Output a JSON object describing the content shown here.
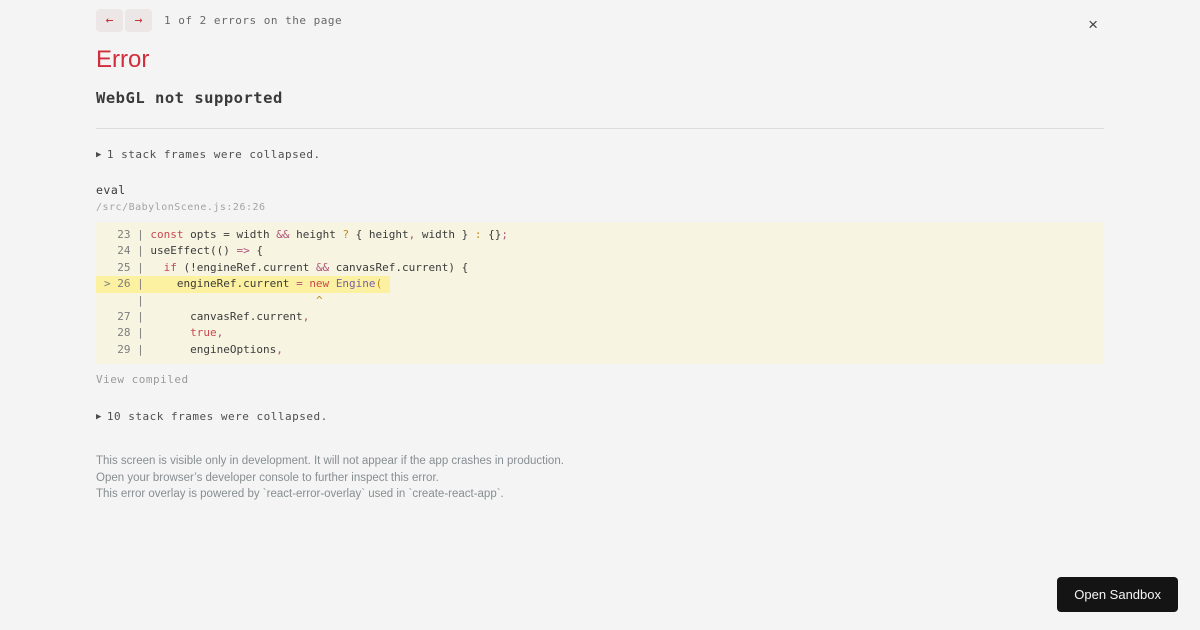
{
  "colors": {
    "page_bg": "#f4f4f4",
    "nav_btn_bg": "#ece6e6",
    "nav_arrow": "#c43333",
    "title_red": "#cf2f3c",
    "code_bg": "#f7f4e2",
    "code_hl_bg": "#fcf0a1",
    "kw": "#c9484f",
    "op": "#ad5176",
    "type": "#7a5cad",
    "punct": "#bf8a1d",
    "sandbox_bg": "#141414"
  },
  "topbar": {
    "prev_label": "←",
    "next_label": "→",
    "counter": "1 of 2 errors on the page",
    "close_label": "×"
  },
  "error": {
    "title": "Error",
    "message": "WebGL not supported"
  },
  "stack": {
    "collapsed_top_icon": "▶",
    "collapsed_top": "1 stack frames were collapsed.",
    "frame_function": "eval",
    "frame_location": "/src/BabylonScene.js:26:26",
    "view_toggle": "View compiled",
    "collapsed_bottom_icon": "▶",
    "collapsed_bottom": "10 stack frames were collapsed."
  },
  "code_frame": {
    "lines": [
      {
        "highlight": false,
        "tokens": [
          [
            "  23 | ",
            "num"
          ],
          [
            "const",
            "kw"
          ],
          [
            " opts = width ",
            "txt"
          ],
          [
            "&&",
            "op"
          ],
          [
            " height ",
            "txt"
          ],
          [
            "?",
            "punct"
          ],
          [
            " { height",
            "txt"
          ],
          [
            ",",
            "op"
          ],
          [
            " width } ",
            "txt"
          ],
          [
            ":",
            "punct"
          ],
          [
            " {}",
            "txt"
          ],
          [
            ";",
            "op"
          ]
        ]
      },
      {
        "highlight": false,
        "tokens": [
          [
            "  24 | ",
            "num"
          ],
          [
            "useEffect(() ",
            "txt"
          ],
          [
            "=>",
            "op"
          ],
          [
            " {",
            "txt"
          ]
        ]
      },
      {
        "highlight": false,
        "tokens": [
          [
            "  25 | ",
            "num"
          ],
          [
            "  ",
            "txt"
          ],
          [
            "if",
            "kw"
          ],
          [
            " (!engineRef.current ",
            "txt"
          ],
          [
            "&&",
            "op"
          ],
          [
            " canvasRef.current) {",
            "txt"
          ]
        ]
      },
      {
        "highlight": true,
        "tokens": [
          [
            "> 26 | ",
            "num"
          ],
          [
            "    engineRef.current ",
            "txt"
          ],
          [
            "=",
            "op"
          ],
          [
            " ",
            "txt"
          ],
          [
            "new",
            "kw"
          ],
          [
            " ",
            "txt"
          ],
          [
            "Engine",
            "type"
          ],
          [
            "(",
            "punct"
          ]
        ]
      },
      {
        "highlight": false,
        "tokens": [
          [
            "     | ",
            "num"
          ],
          [
            "                         ",
            "txt"
          ],
          [
            "^",
            "punct"
          ]
        ]
      },
      {
        "highlight": false,
        "tokens": [
          [
            "  27 | ",
            "num"
          ],
          [
            "      canvasRef.current",
            "txt"
          ],
          [
            ",",
            "op"
          ]
        ]
      },
      {
        "highlight": false,
        "tokens": [
          [
            "  28 | ",
            "num"
          ],
          [
            "      ",
            "txt"
          ],
          [
            "true",
            "kw"
          ],
          [
            ",",
            "op"
          ]
        ]
      },
      {
        "highlight": false,
        "tokens": [
          [
            "  29 | ",
            "num"
          ],
          [
            "      engineOptions",
            "txt"
          ],
          [
            ",",
            "op"
          ]
        ]
      }
    ]
  },
  "footer_lines": [
    "This screen is visible only in development. It will not appear if the app crashes in production.",
    "Open your browser’s developer console to further inspect this error.",
    "This error overlay is powered by `react-error-overlay` used in `create-react-app`."
  ],
  "sandbox_button_label": "Open Sandbox"
}
